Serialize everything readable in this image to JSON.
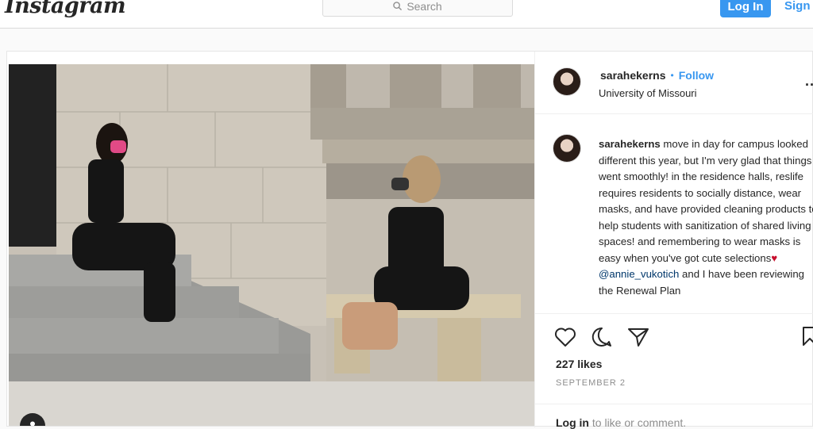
{
  "header": {
    "logo_text": "Instagram",
    "search_placeholder": "Search",
    "login_label": "Log In",
    "signup_label": "Sign"
  },
  "post": {
    "username": "sarahekerns",
    "follow_separator": "•",
    "follow_label": "Follow",
    "location": "University of Missouri",
    "more_label": "...",
    "caption": {
      "username": "sarahekerns",
      "text_part1": " move in day for campus looked different this year, but I'm very glad that things went smoothly! in the residence halls, reslife requires residents to socially distance, wear masks, and have provided cleaning products to help students with sanitization of shared living spaces! and remembering to wear masks is easy when you've got cute selections",
      "heart_emoji": "♥",
      "mention": "@annie_vukotich",
      "text_part2": " and I have been reviewing the Renewal Plan"
    },
    "likes": "227 likes",
    "date": "SEPTEMBER 2",
    "login_prompt_link": "Log in",
    "login_prompt_text": " to like or comment."
  },
  "icons": [
    "search-icon",
    "heart-icon",
    "comment-icon",
    "share-icon",
    "save-icon",
    "user-icon"
  ],
  "colors": {
    "accent": "#3897f0",
    "border": "#dbdbdb",
    "muted": "#8e8e8e"
  }
}
